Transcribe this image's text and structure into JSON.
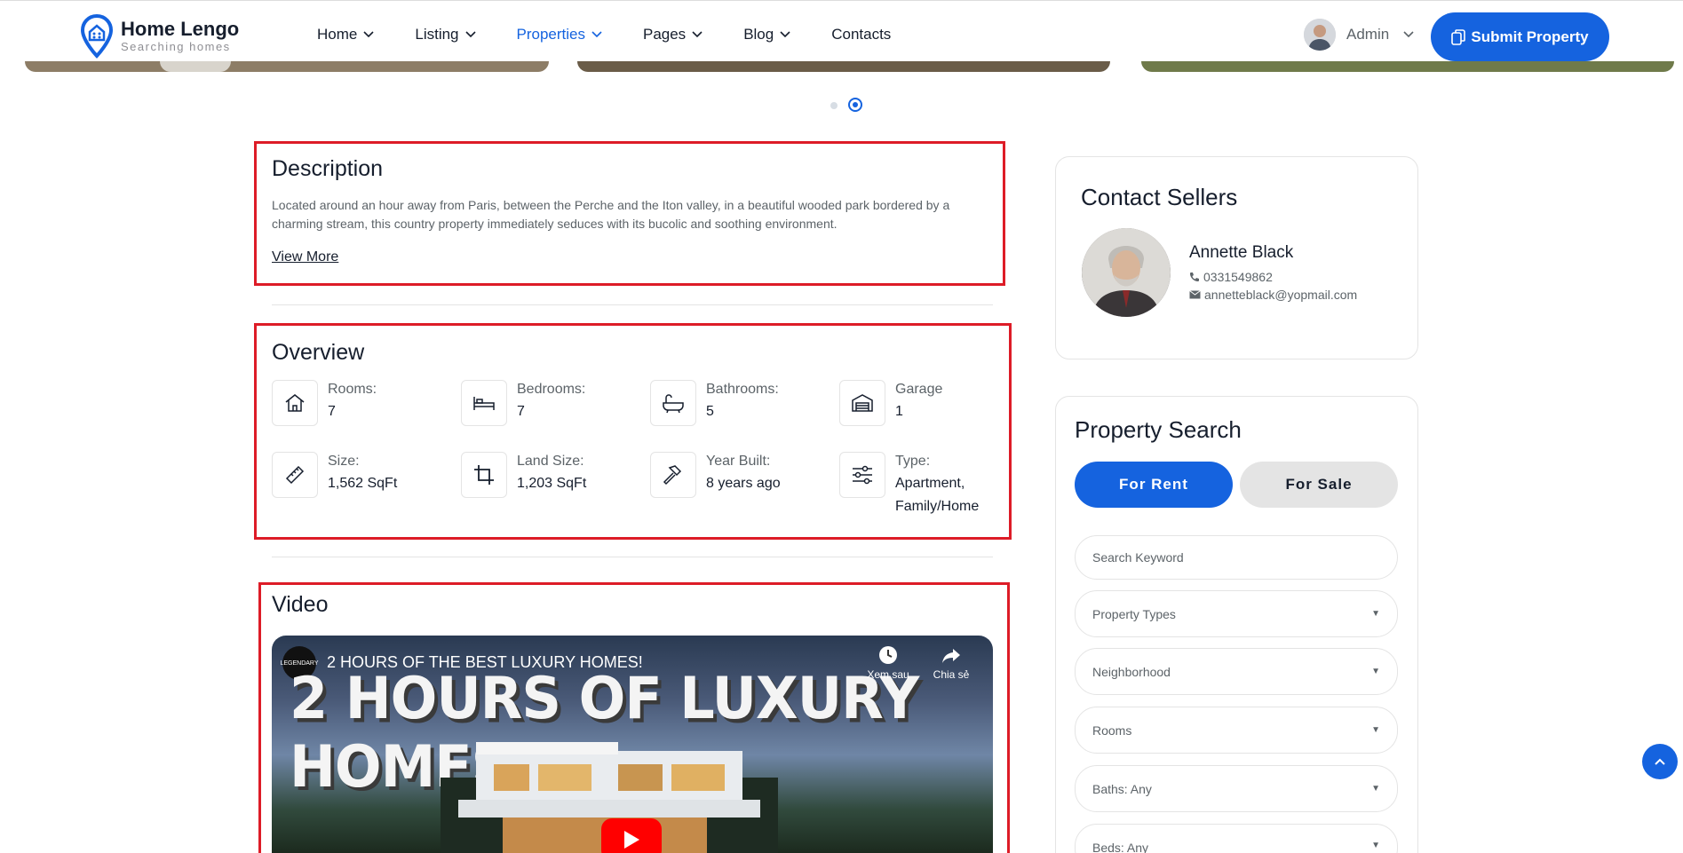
{
  "brand": {
    "title": "Home Lengo",
    "subtitle": "Searching homes"
  },
  "nav": [
    {
      "label": "Home"
    },
    {
      "label": "Listing"
    },
    {
      "label": "Properties"
    },
    {
      "label": "Pages"
    },
    {
      "label": "Blog"
    },
    {
      "label": "Contacts"
    }
  ],
  "user": {
    "name": "Admin"
  },
  "submit_label": "Submit Property",
  "description": {
    "title": "Description",
    "text": "Located around an hour away from Paris, between the Perche and the Iton valley, in a beautiful wooded park bordered by a charming stream, this country property immediately seduces with its bucolic and soothing environment.",
    "view_more": "View More"
  },
  "overview": {
    "title": "Overview",
    "items": [
      {
        "label": "Rooms:",
        "value": "7",
        "icon": "house-icon"
      },
      {
        "label": "Bedrooms:",
        "value": "7",
        "icon": "bed-icon"
      },
      {
        "label": "Bathrooms:",
        "value": "5",
        "icon": "bathtub-icon"
      },
      {
        "label": "Garage",
        "value": "1",
        "icon": "garage-icon"
      },
      {
        "label": "Size:",
        "value": "1,562 SqFt",
        "icon": "ruler-icon"
      },
      {
        "label": "Land Size:",
        "value": "1,203 SqFt",
        "icon": "crop-icon"
      },
      {
        "label": "Year Built:",
        "value": "8 years ago",
        "icon": "hammer-icon"
      },
      {
        "label": "Type:",
        "value": "Apartment, Family/Home",
        "icon": "sliders-icon"
      }
    ]
  },
  "video": {
    "title": "Video",
    "channel": "LEGENDARY",
    "video_title": "2 HOURS OF THE BEST LUXURY HOMES!",
    "thumb_text": "2 HOURS OF LUXURY HOMES",
    "watch_later": "Xem sau",
    "share": "Chia sẻ"
  },
  "contact": {
    "title": "Contact Sellers",
    "name": "Annette Black",
    "phone": "0331549862",
    "email": "annetteblack@yopmail.com"
  },
  "search": {
    "title": "Property Search",
    "tab_rent": "For Rent",
    "tab_sale": "For Sale",
    "keyword_placeholder": "Search Keyword",
    "property_types": "Property Types",
    "neighborhood": "Neighborhood",
    "rooms": "Rooms",
    "baths": "Baths: Any",
    "beds": "Beds: Any"
  },
  "colors": {
    "primary": "#1563df",
    "highlight_box": "#dd1c27",
    "text": "#161e2d",
    "muted": "#5c6368"
  }
}
